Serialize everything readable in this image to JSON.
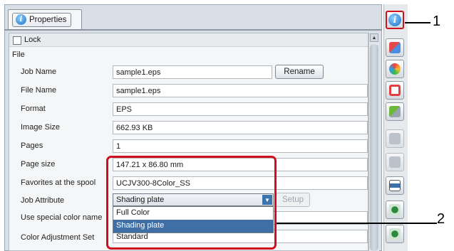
{
  "tab": {
    "label": "Properties"
  },
  "lock": {
    "label": "Lock"
  },
  "section": {
    "label": "File"
  },
  "rows": [
    {
      "label": "Job Name",
      "value": "sample1.eps"
    },
    {
      "label": "File Name",
      "value": "sample1.eps"
    },
    {
      "label": "Format",
      "value": "EPS"
    },
    {
      "label": "Image Size",
      "value": "662.93 KB"
    },
    {
      "label": "Pages",
      "value": "1"
    },
    {
      "label": "Page size",
      "value": "147.21 x 86.80 mm"
    },
    {
      "label": "Favorites at the spool",
      "value": "UCJV300-8Color_SS"
    },
    {
      "label": "Job Attribute",
      "value": "Shading plate"
    },
    {
      "label": "Use special color name",
      "value": ""
    },
    {
      "label": "Color Adjustment Set",
      "value": "Standard"
    }
  ],
  "buttons": {
    "rename": "Rename",
    "setup": "Setup"
  },
  "dropdown": {
    "options": [
      "Full Color",
      "Shading plate"
    ],
    "selected": "Shading plate"
  },
  "callouts": [
    "1",
    "2"
  ],
  "rail_icons": [
    "info-icon",
    "layout-icon",
    "color-icon",
    "frame-icon",
    "tile-icon",
    "split-icon",
    "split-alt-icon",
    "print-icon",
    "move-icon",
    "star-icon"
  ],
  "colors": {
    "highlight": "#d0101e",
    "selection": "#3f6fa5",
    "accent": "#1a6ec8"
  }
}
